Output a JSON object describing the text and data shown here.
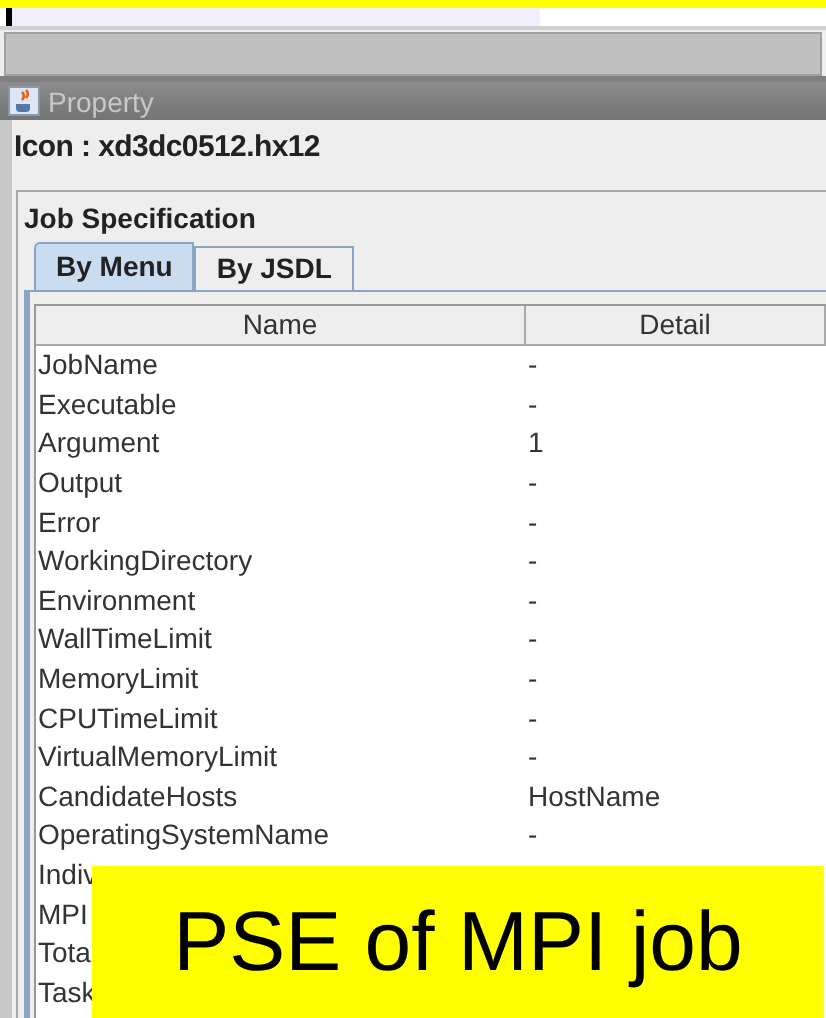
{
  "window": {
    "title": "Property"
  },
  "icon_label": "Icon : xd3dc0512.hx12",
  "panel": {
    "title": "Job Specification"
  },
  "tabs": [
    {
      "label": "By Menu",
      "selected": true
    },
    {
      "label": "By JSDL",
      "selected": false
    }
  ],
  "table": {
    "columns": [
      "Name",
      "Detail"
    ],
    "rows": [
      {
        "name": "JobName",
        "detail": "-"
      },
      {
        "name": "Executable",
        "detail": "-"
      },
      {
        "name": "Argument",
        "detail": "1"
      },
      {
        "name": "Output",
        "detail": "-"
      },
      {
        "name": "Error",
        "detail": "-"
      },
      {
        "name": "WorkingDirectory",
        "detail": "-"
      },
      {
        "name": "Environment",
        "detail": "-"
      },
      {
        "name": "WallTimeLimit",
        "detail": "-"
      },
      {
        "name": "MemoryLimit",
        "detail": "-"
      },
      {
        "name": "CPUTimeLimit",
        "detail": "-"
      },
      {
        "name": "VirtualMemoryLimit",
        "detail": "-"
      },
      {
        "name": "CandidateHosts",
        "detail": "HostName"
      },
      {
        "name": "OperatingSystemName",
        "detail": "-"
      },
      {
        "name": "Indiv"
      },
      {
        "name": "MPI"
      },
      {
        "name": "Tota"
      },
      {
        "name": "Task"
      }
    ]
  },
  "caption": "PSE of MPI job"
}
